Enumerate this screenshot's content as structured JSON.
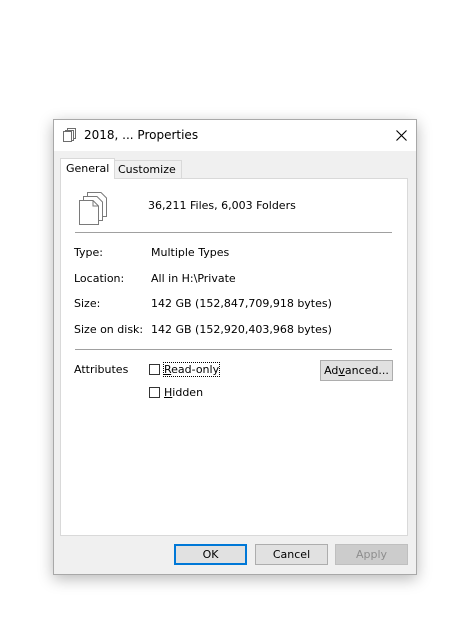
{
  "window": {
    "title": "2018, ... Properties",
    "icon": "files-icon",
    "close_icon": "close-icon"
  },
  "tabs": [
    {
      "label": "General",
      "active": true
    },
    {
      "label": "Customize",
      "active": false
    }
  ],
  "general": {
    "summary": "36,211 Files, 6,003 Folders",
    "properties": [
      {
        "label": "Type:",
        "value": "Multiple Types"
      },
      {
        "label": "Location:",
        "value": "All in H:\\Private"
      },
      {
        "label": "Size:",
        "value": "142 GB (152,847,709,918 bytes)"
      },
      {
        "label": "Size on disk:",
        "value": "142 GB (152,920,403,968 bytes)"
      }
    ],
    "attributes": {
      "label": "Attributes",
      "read_only": {
        "label_rest": "ead-only",
        "underline": "R",
        "checked": false
      },
      "hidden": {
        "label_rest": "idden",
        "underline": "H",
        "checked": false
      },
      "advanced_button": {
        "underline": "v",
        "pre": "Ad",
        "post": "anced..."
      }
    }
  },
  "buttons": {
    "ok": "OK",
    "cancel": "Cancel",
    "apply": "Apply"
  },
  "colors": {
    "accent": "#0078d7",
    "dialog_bg": "#f0f0f0",
    "panel_bg": "#ffffff"
  }
}
